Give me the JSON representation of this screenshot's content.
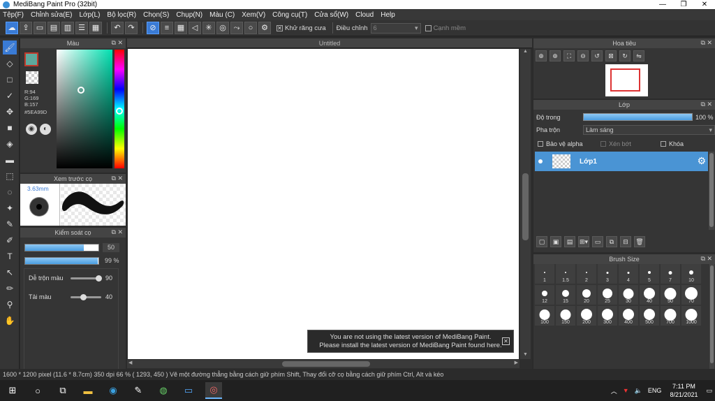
{
  "window": {
    "title": "MediBang Paint Pro (32bit)",
    "min": "—",
    "max": "❐",
    "close": "✕"
  },
  "menu": [
    "Tệp(F)",
    "Chỉnh sửa(E)",
    "Lớp(L)",
    "Bộ lọc(R)",
    "Chọn(S)",
    "Chụp(N)",
    "Màu (C)",
    "Xem(V)",
    "Công cụ(T)",
    "Cửa sổ(W)",
    "Cloud",
    "Help"
  ],
  "toolbar": {
    "antialias": "Khử răng cưa",
    "adjust": "Điều chỉnh",
    "adjust_value": "6",
    "edge": "Cạnh mềm"
  },
  "color_panel": {
    "title": "Màu",
    "r": "R:94",
    "g": "G:169",
    "b": "B:157",
    "hex": "#5EA99D",
    "fg_color": "#5EA99D"
  },
  "brush_preview": {
    "title": "Xem trước cọ",
    "size": "3.63mm"
  },
  "brush_control": {
    "title": "Kiểm soát cọ",
    "size_value": "50",
    "size_fill": 0.8,
    "opacity_value": "99 %",
    "opacity_fill": 0.99,
    "mix_label": "Dễ trộn màu",
    "mix_value": "90",
    "mix_level": 0.9,
    "amount_label": "Tải màu",
    "amount_value": "40",
    "amount_level": 0.4
  },
  "document": {
    "tab": "Untitled"
  },
  "notice": {
    "line1": "You are not using the latest version of MediBang Paint.",
    "line2": "Please install the latest version of MediBang Paint found here."
  },
  "navigator": {
    "title": "Hoa tiêu"
  },
  "layers": {
    "title": "Lớp",
    "opacity_label": "Độ trong",
    "opacity_value": "100 %",
    "blend_label": "Pha trộn",
    "blend_value": "Làm sáng",
    "protect_alpha": "Bảo vệ alpha",
    "clip": "Xén bớt",
    "lock": "Khóa",
    "layer_name": "Lớp1"
  },
  "brush_size": {
    "title": "Brush Size",
    "sizes": [
      "1",
      "1.5",
      "2",
      "3",
      "4",
      "5",
      "7",
      "10",
      "12",
      "15",
      "20",
      "25",
      "30",
      "40",
      "50",
      "70",
      "100",
      "150",
      "200",
      "300",
      "400",
      "500",
      "700",
      "1000"
    ]
  },
  "status": "1600 * 1200 pixel   (11.6 * 8.7cm)   350 dpi   66 %   ( 1293, 450 )   Vẽ một đường thẳng bằng cách giữ phím Shift, Thay đổi cỡ cọ bằng cách giữ phím Ctrl, Alt và kéo",
  "taskbar": {
    "lang": "ENG",
    "time": "7:11 PM",
    "date": "8/21/2021"
  }
}
